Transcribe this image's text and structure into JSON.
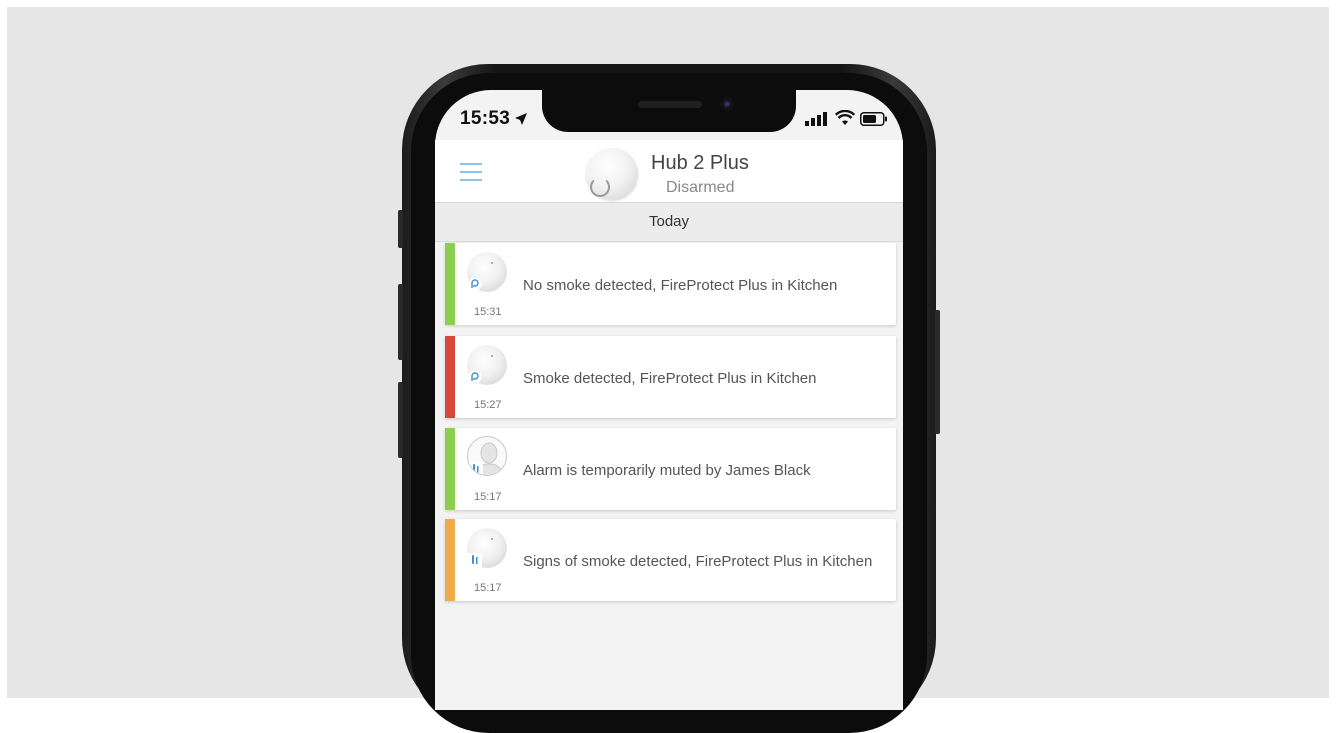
{
  "status_bar": {
    "time": "15:53",
    "location_icon": "location-arrow-icon",
    "signal_icon": "cellular-signal-icon",
    "wifi_icon": "wifi-icon",
    "battery_icon": "battery-icon"
  },
  "header": {
    "menu_icon": "hamburger-menu-icon",
    "hub_name": "Hub 2 Plus",
    "hub_status": "Disarmed"
  },
  "date_group": "Today",
  "events": [
    {
      "time": "15:31",
      "text": "No smoke detected, FireProtect Plus in Kitchen",
      "status_color": "#8ccf4d",
      "device_icon": "fireprotect-device-icon",
      "badge_icon": "smoke-sensor-badge-icon"
    },
    {
      "time": "15:27",
      "text": "Smoke detected, FireProtect Plus in Kitchen",
      "status_color": "#d6473c",
      "device_icon": "fireprotect-device-icon",
      "badge_icon": "smoke-sensor-badge-icon"
    },
    {
      "time": "15:17",
      "text": "Alarm is temporarily muted by James Black",
      "status_color": "#8ccf4d",
      "device_icon": "user-avatar-icon",
      "badge_icon": "mute-badge-icon"
    },
    {
      "time": "15:17",
      "text": "Signs of smoke detected, FireProtect Plus in Kitchen",
      "status_color": "#f0ac4b",
      "device_icon": "fireprotect-device-icon",
      "badge_icon": "temperature-badge-icon"
    }
  ],
  "colors": {
    "accent": "#8cc4e8",
    "background": "#e6e6e6"
  }
}
